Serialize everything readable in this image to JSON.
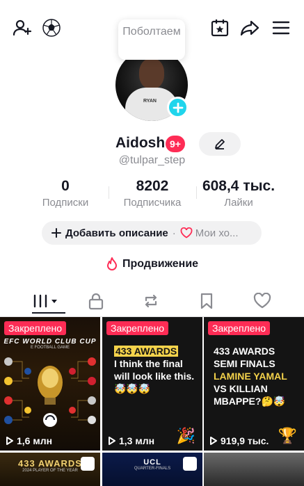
{
  "profile": {
    "tooltip": "Поболтаем",
    "name": "Aidosh",
    "notification_badge": "9+",
    "handle": "@tulpar_step",
    "avatar_label": "RYAN"
  },
  "stats": [
    {
      "value": "0",
      "label": "Подписки"
    },
    {
      "value": "8202",
      "label": "Подписчика"
    },
    {
      "value": "608,4 тыс.",
      "label": "Лайки"
    }
  ],
  "description": {
    "add_label": "Добавить описание",
    "separator": "·",
    "favorites_label": "Мои хо..."
  },
  "promotion": {
    "label": "Продвижение"
  },
  "tabs": [
    {
      "icon": "grid-icon",
      "active": true
    },
    {
      "icon": "lock-icon",
      "active": false
    },
    {
      "icon": "repost-icon",
      "active": false
    },
    {
      "icon": "bookmark-icon",
      "active": false
    },
    {
      "icon": "heart-icon",
      "active": false
    }
  ],
  "videos": [
    {
      "pinned_label": "Закреплено",
      "views": "1,6 млн",
      "title": "EFC WORLD CLUB CUP",
      "subtitle": "E FOOTBALL GAME"
    },
    {
      "pinned_label": "Закреплено",
      "views": "1,3 млн",
      "headline": "433 AWARDS",
      "body": "I think the final will look like this.",
      "emojis": "🤯🤯🤯"
    },
    {
      "pinned_label": "Закреплено",
      "views": "919,9 тыс.",
      "line1": "433 AWARDS",
      "line2": "SEMI FINALS",
      "line3": "LAMINE YAMAL",
      "line4": "VS KILLIAN",
      "line5": "MBAPPE",
      "emojis": "?🤔🤯"
    },
    {
      "title": "433 AWARDS",
      "subtitle": "2024 PLAYER OF THE YEAR"
    },
    {
      "title": "UCL",
      "subtitle": "QUARTER-FINALS"
    },
    {
      "title": ""
    }
  ],
  "colors": {
    "accent": "#fe2c55",
    "cyan": "#20d5ec",
    "text": "#161823",
    "muted": "#8a8b91"
  }
}
